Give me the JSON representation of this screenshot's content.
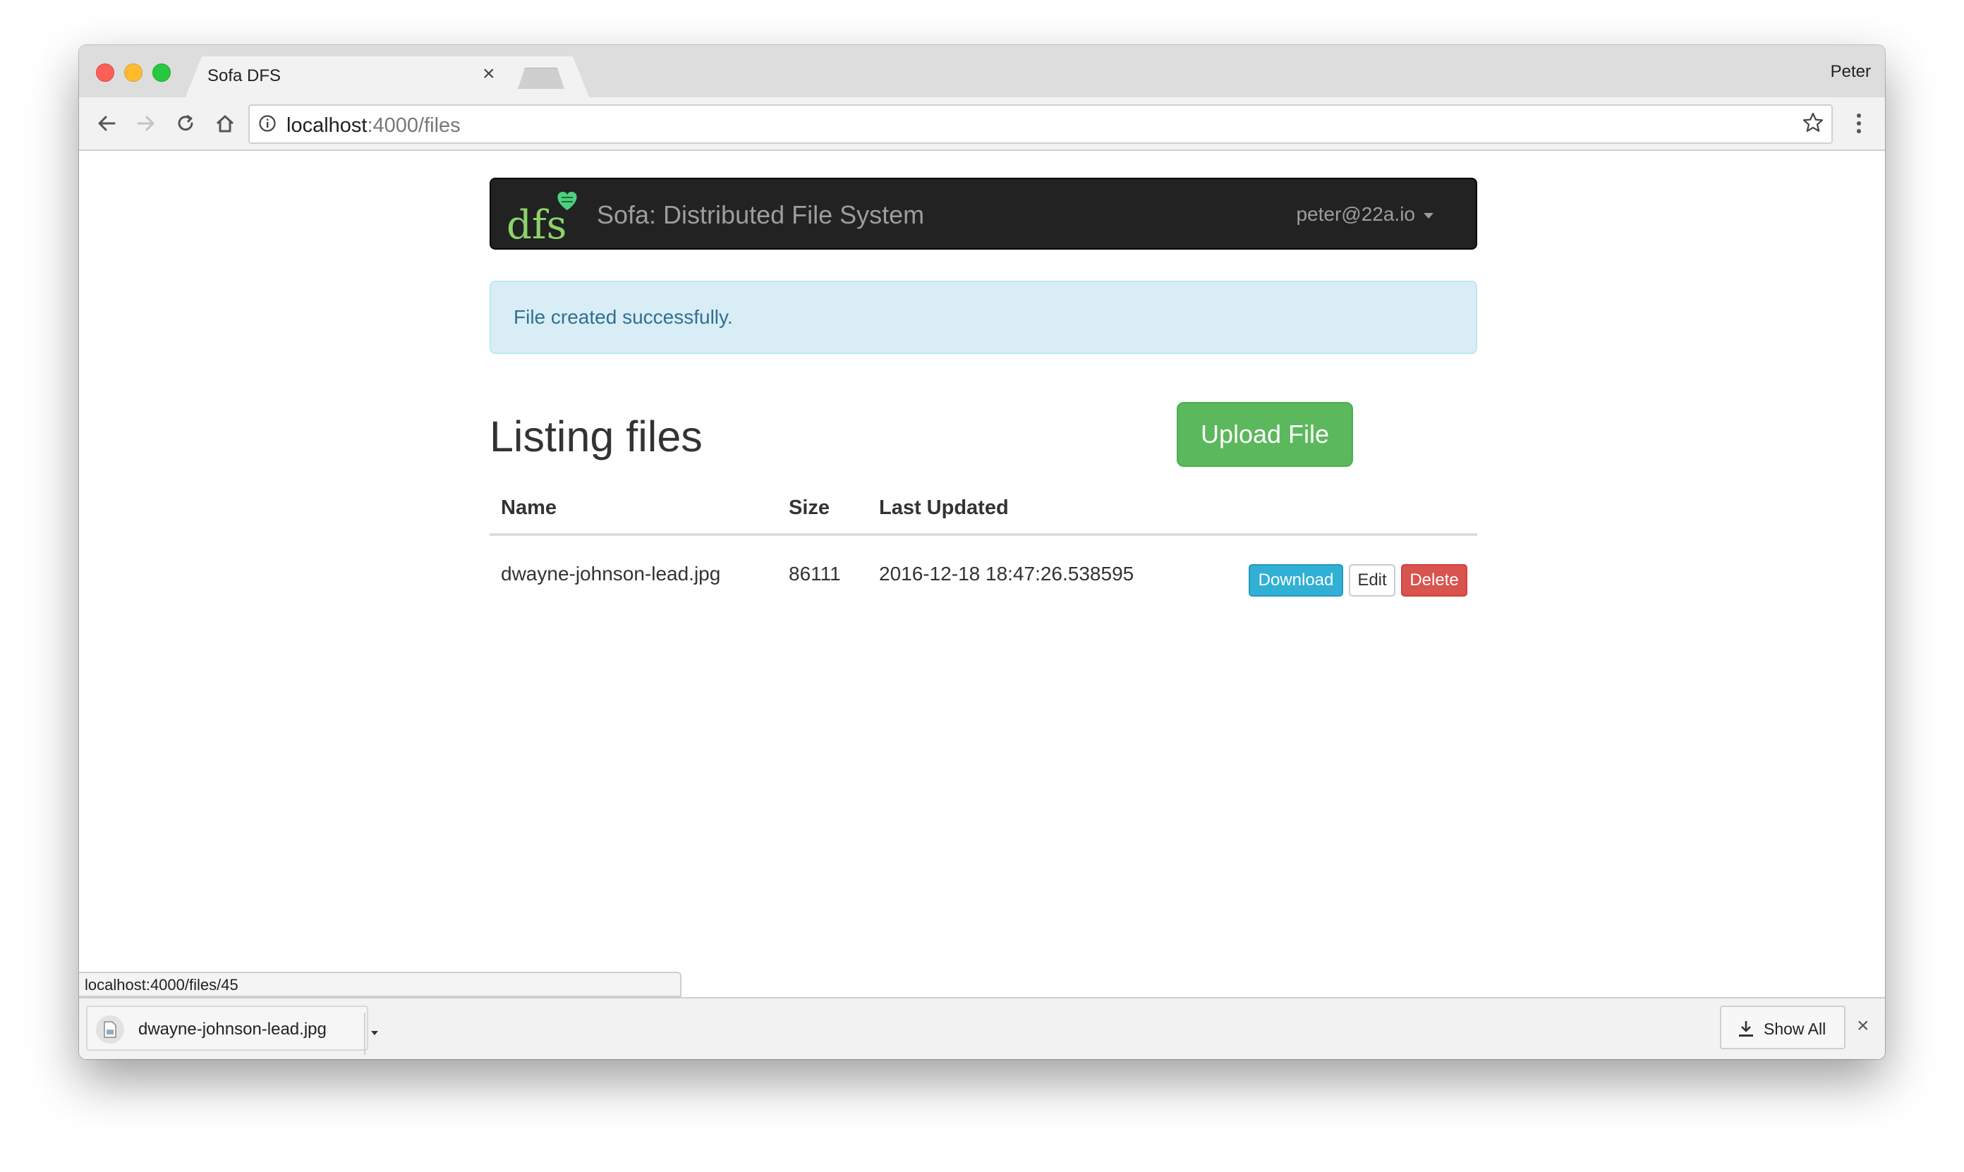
{
  "browser": {
    "tab_title": "Sofa DFS",
    "tab_close": "×",
    "profile_name": "Peter",
    "url_host": "localhost",
    "url_rest": ":4000/files"
  },
  "app": {
    "logo_text": "dfs",
    "brand": "Sofa: Distributed File System",
    "user_email": "peter@22a.io",
    "alert": "File created successfully.",
    "page_title": "Listing files",
    "upload_label": "Upload File",
    "table": {
      "headers": [
        "Name",
        "Size",
        "Last Updated"
      ],
      "rows": [
        {
          "name": "dwayne-johnson-lead.jpg",
          "size": "86111",
          "updated": "2016-12-18 18:47:26.538595",
          "download_label": "Download",
          "edit_label": "Edit",
          "delete_label": "Delete"
        }
      ]
    }
  },
  "status_bar": {
    "url": "localhost:4000/files/45"
  },
  "download_shelf": {
    "file_name": "dwayne-johnson-lead.jpg",
    "show_all_label": "Show All",
    "close_glyph": "×"
  },
  "colors": {
    "navbar_bg": "#222222",
    "logo_green": "#8dd36b",
    "heart_green": "#4cd07d",
    "alert_bg": "#d9edf7",
    "alert_text": "#31708f",
    "upload_green": "#5cb85c",
    "download_blue": "#31b0d5",
    "delete_red": "#d9534f"
  }
}
